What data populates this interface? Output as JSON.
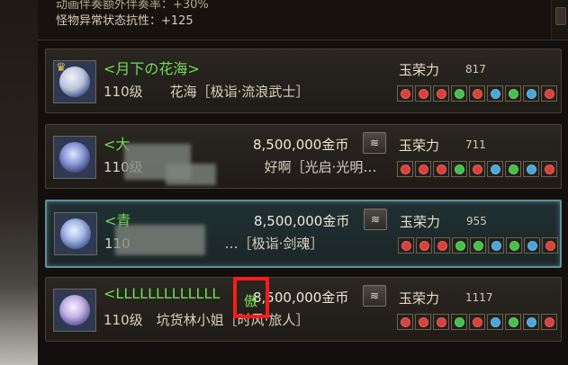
{
  "header": {
    "line1": "动画伴奏额外伴奏率：+30%",
    "line2": "怪物异常状态抗性：+125"
  },
  "colors": {
    "name_green": "#70dd58",
    "selected_border": "#5f8f9b",
    "highlight_red": "#ff1a1a"
  },
  "rows": [
    {
      "name": "<月下の花海>",
      "info": "110级　　花海［极诣·流浪武士］",
      "price": "",
      "glory_label": "玉荣力",
      "glory_value": "817"
    },
    {
      "name": "<大",
      "info": "110级　　　　　　　　　好啊［光启·光明…",
      "price": "8,500,000金币",
      "glory_label": "玉荣力",
      "glory_value": "711"
    },
    {
      "name": "<青",
      "info": "110　　　　　　　…［极诣·剑魂］",
      "price": "8,500,000金币",
      "glory_label": "玉荣力",
      "glory_value": "955"
    },
    {
      "name": "<LLLLLLLLLLLLL",
      "info": "110级　坑货林小姐［时风·旅人］",
      "price": "8,500,000金币",
      "glory_label": "玉荣力",
      "glory_value": "1117"
    }
  ],
  "highlight_char": "傲",
  "gem_colors": [
    "#d9403a",
    "#d9403a",
    "#d9403a",
    "#45c04a",
    "#d9403a",
    "#4aa6d9",
    "#45c04a",
    "#4aa6d9",
    "#d9403a"
  ],
  "icons": {
    "buy": "coin-stack-icon",
    "crown": "crown-icon"
  }
}
